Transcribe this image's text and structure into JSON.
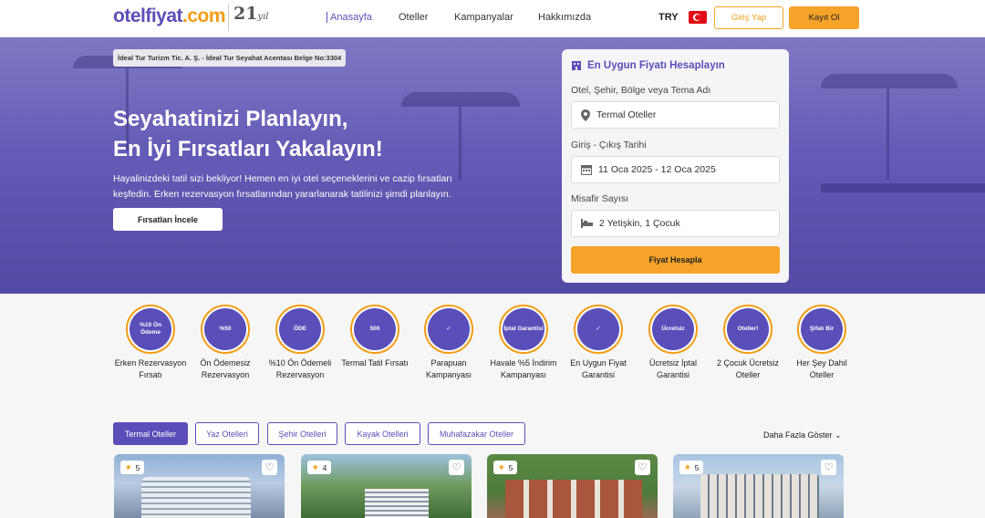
{
  "header": {
    "logo_main": "otelfiyat",
    "logo_tld": ".com",
    "logo_badge": "21",
    "logo_badge_suffix": "yıl",
    "nav": [
      "Anasayfa",
      "Oteller",
      "Kampanyalar",
      "Hakkımızda"
    ],
    "currency": "TRY",
    "login_label": "Giriş Yap",
    "register_label": "Kayıt Ol"
  },
  "hero": {
    "license": "İdeal Tur Turizm Tic. A. Ş. - İdeal Tur Seyahat Acentası Belge No:3304",
    "title_line1": "Seyahatinizi Planlayın,",
    "title_line2": "En İyi Fırsatları Yakalayın!",
    "subtitle": "Hayalinizdeki tatil sizi bekliyor! Hemen en iyi otel seçeneklerini ve cazip fırsatları keşfedin. Erken rezervasyon fırsatlarından yararlanarak tatilinizi şimdi planlayın.",
    "cta_label": "Fırsatları İncele"
  },
  "calculator": {
    "title": "En Uygun Fiyatı Hesaplayın",
    "location_label": "Otel, Şehir, Bölge veya Tema Adı",
    "location_value": "Termal Oteller",
    "dates_label": "Giriş - Çıkış Tarihi",
    "dates_value": "11 Oca 2025 - 12 Oca 2025",
    "guests_label": "Misafir Sayısı",
    "guests_value": "2 Yetişkin, 1 Çocuk",
    "submit_label": "Fiyat Hesapla"
  },
  "campaigns": [
    {
      "label": "Erken Rezervasyon Fırsatı",
      "badge": "%10 Ön Ödeme"
    },
    {
      "label": "Ön Ödemesiz Rezervasyon",
      "badge": "%50"
    },
    {
      "label": "%10 Ön Ödemeli Rezervasyon",
      "badge": "ÖDE"
    },
    {
      "label": "Termal Tatil Fırsatı",
      "badge": "500"
    },
    {
      "label": "Parapuan Kampanyası",
      "badge": "✓"
    },
    {
      "label": "Havale %5 İndirim Kampanyası",
      "badge": "İptal Garantisi"
    },
    {
      "label": "En Uygun Fiyat Garantisi",
      "badge": "✓"
    },
    {
      "label": "Ücretsiz İptal Garantisi",
      "badge": "Ücretsiz"
    },
    {
      "label": "2 Çocuk Ücretsiz Oteller",
      "badge": "Oteller!"
    },
    {
      "label": "Her Şey Dahil Oteller",
      "badge": "Şifalı Bir"
    }
  ],
  "tabs": [
    "Termal Oteller",
    "Yaz Otelleri",
    "Şehir Otelleri",
    "Kayak Otelleri",
    "Muhafazakar Oteller"
  ],
  "more_label": "Daha Fazla Göster",
  "hotels": [
    {
      "stars": "5"
    },
    {
      "stars": "4"
    },
    {
      "stars": "5"
    },
    {
      "stars": "5"
    }
  ],
  "colors": {
    "brand": "#5a4fb8",
    "accent": "#f6a32a"
  }
}
